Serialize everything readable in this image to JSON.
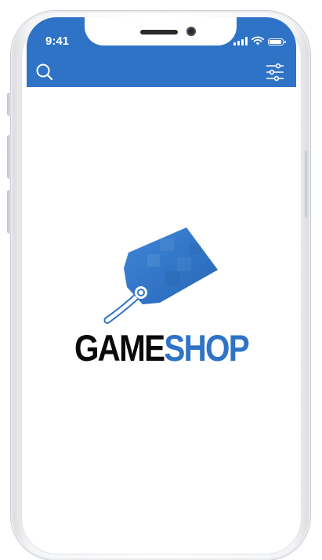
{
  "status_bar": {
    "time": "9:41",
    "signal_icon": "cellular-signal-icon",
    "wifi_icon": "wifi-icon",
    "battery_icon": "battery-icon",
    "battery_level": 0.85
  },
  "header": {
    "search_icon": "search-icon",
    "filter_icon": "sliders-icon"
  },
  "logo": {
    "icon": "price-tag-icon",
    "word_part1": "GAME",
    "word_part2": "SHOP"
  },
  "colors": {
    "brand_blue": "#2f73c7",
    "wordmark_dark": "#0a0a0a",
    "background": "#ffffff"
  }
}
